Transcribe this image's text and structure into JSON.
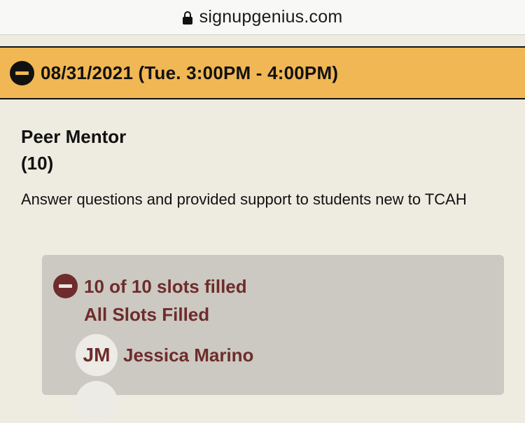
{
  "browser": {
    "domain": "signupgenius.com",
    "lock_icon": "lock-icon"
  },
  "date_header": {
    "icon": "collapse-icon",
    "text": "08/31/2021 (Tue. 3:00PM - 4:00PM)",
    "background": "#f0b754"
  },
  "slot": {
    "title": "Peer Mentor",
    "count": "(10)",
    "description": "Answer questions and provided support to students new to TCAH"
  },
  "signups": {
    "icon": "collapse-icon",
    "status": "10 of 10 slots filled",
    "substatus": "All Slots Filled",
    "accent": "#6e2c2c",
    "volunteers": [
      {
        "initials": "JM",
        "name": "Jessica Marino"
      }
    ]
  }
}
